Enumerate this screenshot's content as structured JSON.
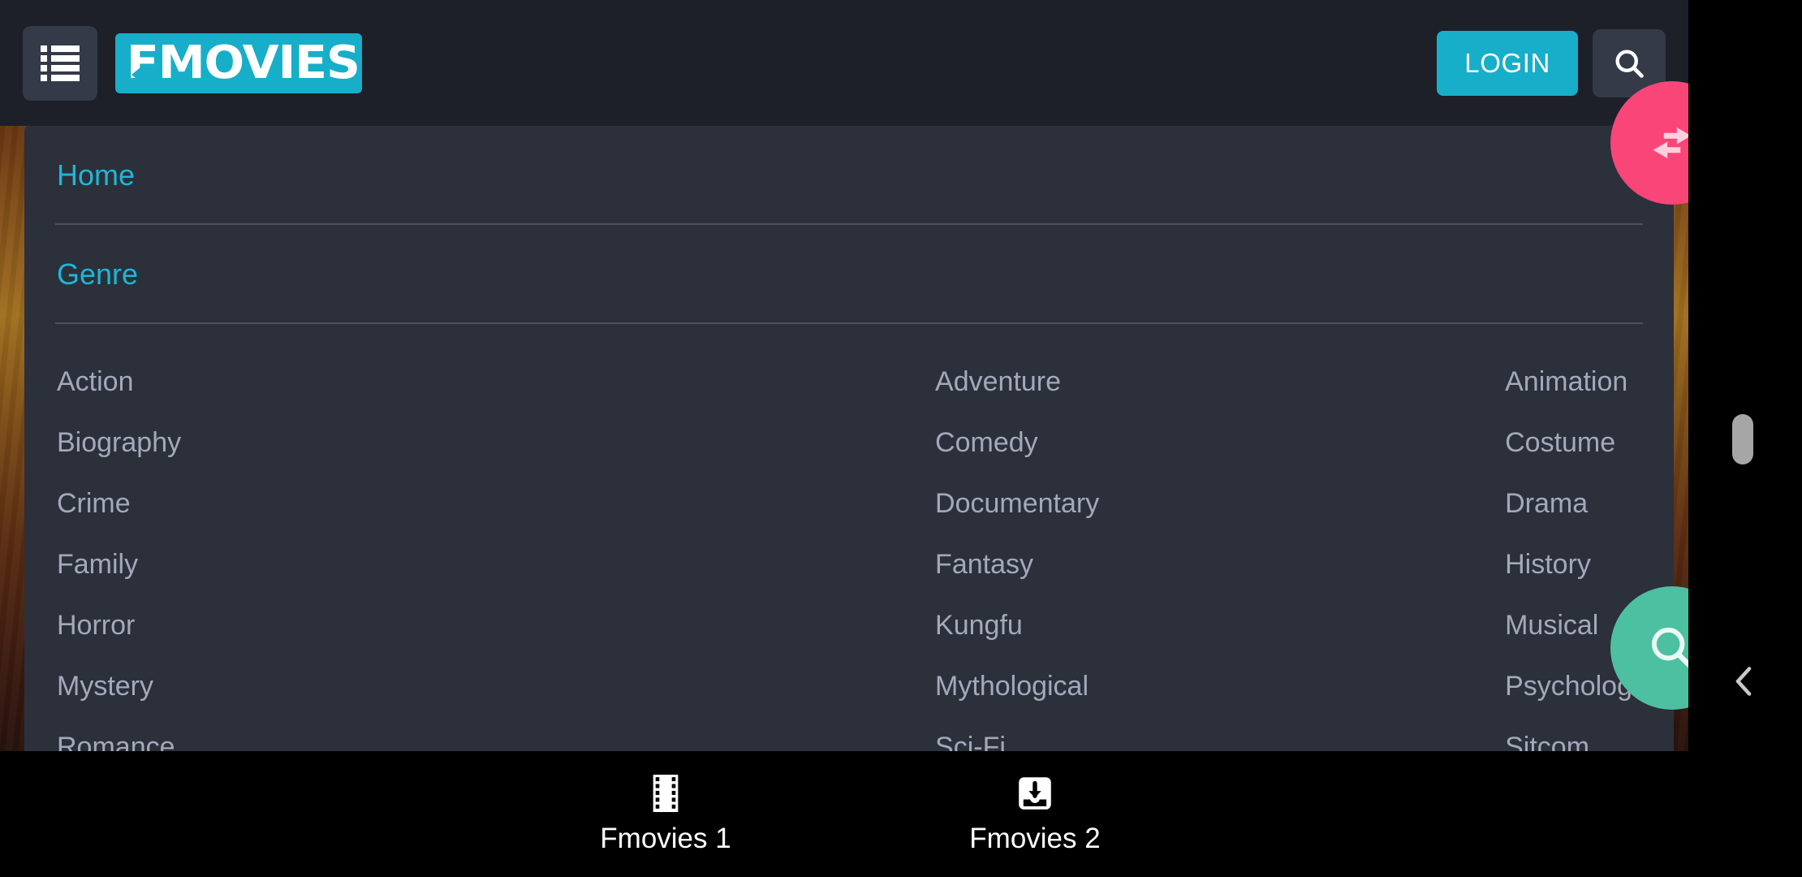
{
  "colors": {
    "brand_cyan": "#17aec9",
    "link_cyan": "#1fb6d6",
    "header_bg": "#1d2028",
    "panel_bg": "#2b303b",
    "genre_text": "#a3a9b8",
    "fab_pink": "#fa4579",
    "fab_green": "#4cc0a0",
    "bottom_bar_bg": "#000000"
  },
  "header": {
    "menu_icon": "list-icon",
    "logo_text": "FMOVIES",
    "login_label": "LOGIN",
    "search_icon": "search-icon"
  },
  "menu": {
    "home_label": "Home",
    "genre_label": "Genre",
    "genres": [
      "Action",
      "Adventure",
      "Animation",
      "Biography",
      "Comedy",
      "Costume",
      "Crime",
      "Documentary",
      "Drama",
      "Family",
      "Fantasy",
      "History",
      "Horror",
      "Kungfu",
      "Musical",
      "Mystery",
      "Mythological",
      "Psychological",
      "Romance",
      "Sci-Fi",
      "Sitcom"
    ]
  },
  "fabs": [
    {
      "name": "swap-compare-fab",
      "icon": "swap-horizontal-icon",
      "color": "#fa4579"
    },
    {
      "name": "search-fab",
      "icon": "search-icon",
      "color": "#4cc0a0"
    }
  ],
  "bottom_nav": {
    "items": [
      {
        "label": "Fmovies 1",
        "icon": "film-strip-icon"
      },
      {
        "label": "Fmovies 2",
        "icon": "download-inbox-icon"
      }
    ]
  },
  "system": {
    "back_icon": "chevron-left-icon",
    "scrollbar": "vertical-scroll-thumb"
  }
}
